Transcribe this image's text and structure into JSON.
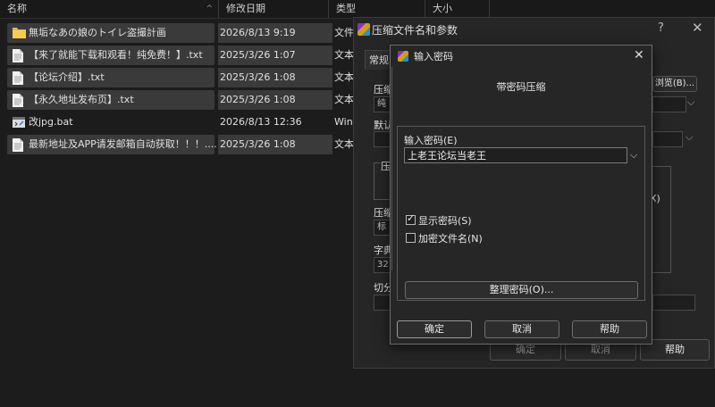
{
  "explorer": {
    "columns": {
      "name": "名称",
      "modified": "修改日期",
      "type": "类型",
      "size": "大小"
    },
    "files": [
      {
        "icon": "folder-icon",
        "name": "無垢なあの娘のトイレ盗撮計画",
        "date": "2026/8/13 9:19",
        "type": "文件",
        "selected": true
      },
      {
        "icon": "text-file-icon",
        "name": "【来了就能下载和观看！纯免费！】.txt",
        "date": "2025/3/26 1:07",
        "type": "文本",
        "selected": true
      },
      {
        "icon": "text-file-icon",
        "name": "【论坛介绍】.txt",
        "date": "2025/3/26 1:08",
        "type": "文本",
        "selected": true
      },
      {
        "icon": "text-file-icon",
        "name": "【永久地址发布页】.txt",
        "date": "2025/3/26 1:08",
        "type": "文本",
        "selected": true
      },
      {
        "icon": "batch-file-icon",
        "name": "改jpg.bat",
        "date": "2026/8/13 12:36",
        "type": "Win",
        "selected": false
      },
      {
        "icon": "text-file-icon",
        "name": "最新地址及APP请发邮箱自动获取！！！....",
        "date": "2025/3/26 1:08",
        "type": "文本",
        "selected": true
      }
    ]
  },
  "archive_dialog": {
    "title": "压缩文件名和参数",
    "help_glyph": "?",
    "close_glyph": "✕",
    "tab_general": "常规",
    "browse_button": "浏览(B)...",
    "label_archive": "压缩",
    "archive_value": "纯洁",
    "label_default": "默认",
    "label_group": "压",
    "label_method": "压缩",
    "method_value": "标",
    "label_dict": "字典",
    "dict_value": "32",
    "label_split": "切分",
    "x_glyph": "X)",
    "ok_button": "确定",
    "cancel_button": "取消",
    "help_button": "帮助"
  },
  "password_dialog": {
    "title": "输入密码",
    "close_glyph": "✕",
    "heading": "带密码压缩",
    "password_label": "输入密码(E)",
    "password_value": "上老王论坛当老王",
    "show_password": {
      "label": "显示密码(S)",
      "checked": true
    },
    "encrypt_names": {
      "label": "加密文件名(N)",
      "checked": false
    },
    "organize_button": "整理密码(O)...",
    "ok_button": "确定",
    "cancel_button": "取消",
    "help_button": "帮助"
  }
}
